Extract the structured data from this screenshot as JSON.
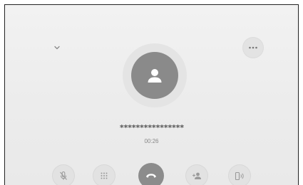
{
  "call": {
    "caller_number": "****************",
    "duration": "00:26"
  },
  "icons": {
    "collapse": "chevron-down-icon",
    "more": "more-options-icon",
    "avatar": "person-icon",
    "mute": "microphone-off-icon",
    "keypad": "dialpad-icon",
    "end_call": "phone-hangup-icon",
    "add_call": "add-person-icon",
    "audio_output": "phone-speaker-icon"
  },
  "colors": {
    "background": "#ececec",
    "avatar": "#8a8a8a",
    "end_call_button": "#8c8c8c",
    "icon": "#9a9a9a"
  }
}
